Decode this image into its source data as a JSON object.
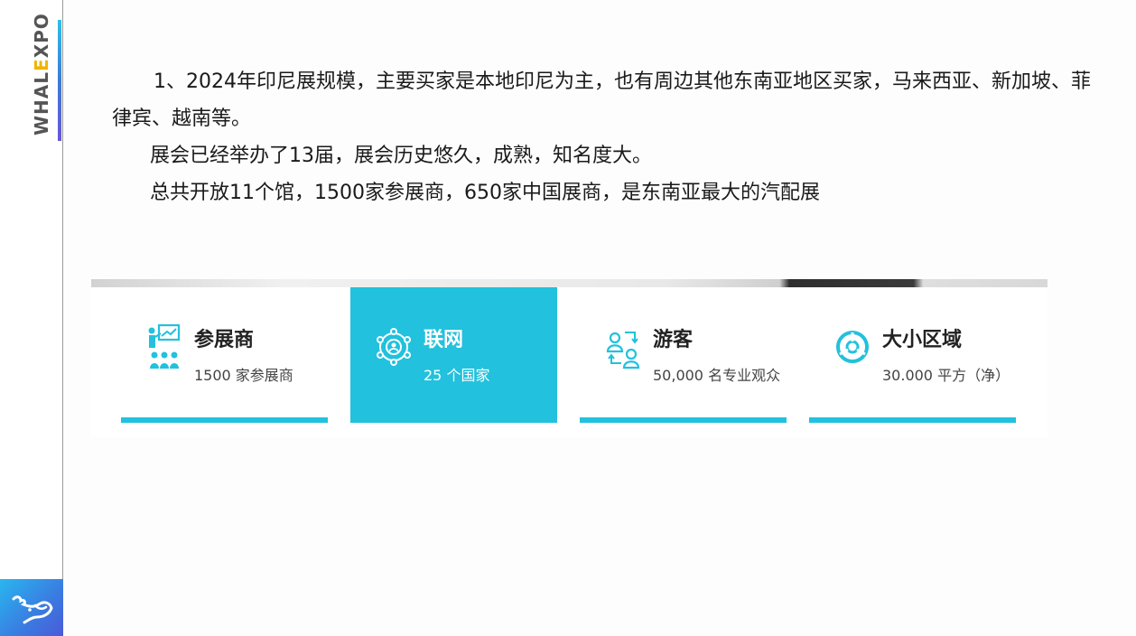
{
  "sidebar": {
    "brand_left": "WHAL",
    "brand_mid": "E",
    "brand_right": "XPO",
    "logo_icon": "whale-logo-icon"
  },
  "paragraphs": [
    "1、2024年印尼展规模，主要买家是本地印尼为主，也有周边其他东南亚地区买家，马来西亚、新加坡、菲律宾、越南等。",
    "展会已经举办了13届，展会历史悠久，成熟，知名度大。",
    "总共开放11个馆，1500家参展商，650家中国展商，是东南亚最大的汽配展"
  ],
  "stats": [
    {
      "title": "参展商",
      "subtitle": "1500 家参展商",
      "icon": "presenter-audience-icon"
    },
    {
      "title": "联网",
      "subtitle": "25 个国家",
      "icon": "network-people-icon"
    },
    {
      "title": "游客",
      "subtitle": "50,000 名专业观众",
      "icon": "visitors-exchange-icon"
    },
    {
      "title": "大小区域",
      "subtitle": "30.000 平方（净）",
      "icon": "pie-area-icon"
    }
  ],
  "colors": {
    "accent": "#22c1dd",
    "brand_highlight": "#f0b400",
    "brand_text": "#555555",
    "logo_gradient": [
      "#29b6f0",
      "#4b5ad8"
    ]
  }
}
